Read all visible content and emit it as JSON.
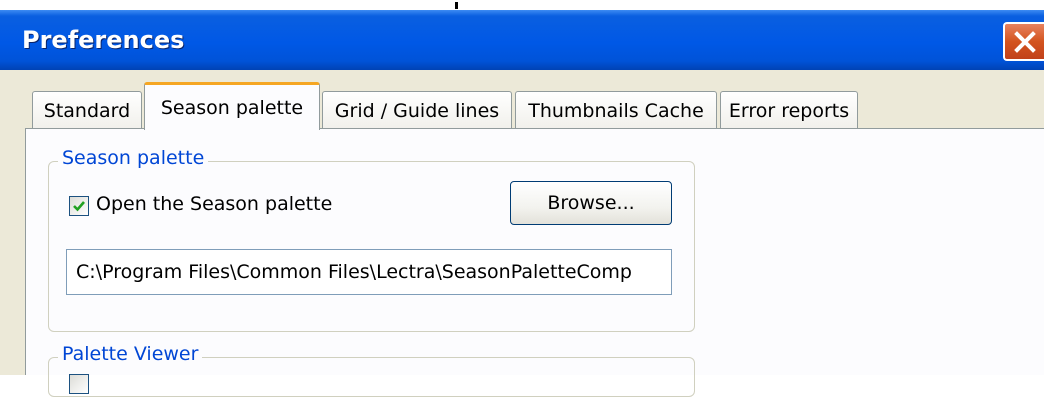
{
  "window": {
    "title": "Preferences",
    "close_icon": "close-x-icon"
  },
  "tabs": [
    {
      "label": "Standard",
      "active": false
    },
    {
      "label": "Season palette",
      "active": true
    },
    {
      "label": "Grid / Guide lines",
      "active": false
    },
    {
      "label": "Thumbnails Cache",
      "active": false
    },
    {
      "label": "Error reports",
      "active": false
    }
  ],
  "season_palette": {
    "group_title": "Season palette",
    "open_checkbox": {
      "label": "Open the Season palette",
      "checked": true
    },
    "browse_label": "Browse...",
    "path_value": "C:\\Program Files\\Common Files\\Lectra\\SeasonPaletteComp"
  },
  "palette_viewer": {
    "group_title": "Palette Viewer",
    "checkbox_checked": false
  },
  "colors": {
    "titlebar": "#0058e6",
    "close_button": "#d3541f",
    "group_title": "#0046d5",
    "active_tab_accent": "#f5a623",
    "checkmark": "#21a121"
  }
}
